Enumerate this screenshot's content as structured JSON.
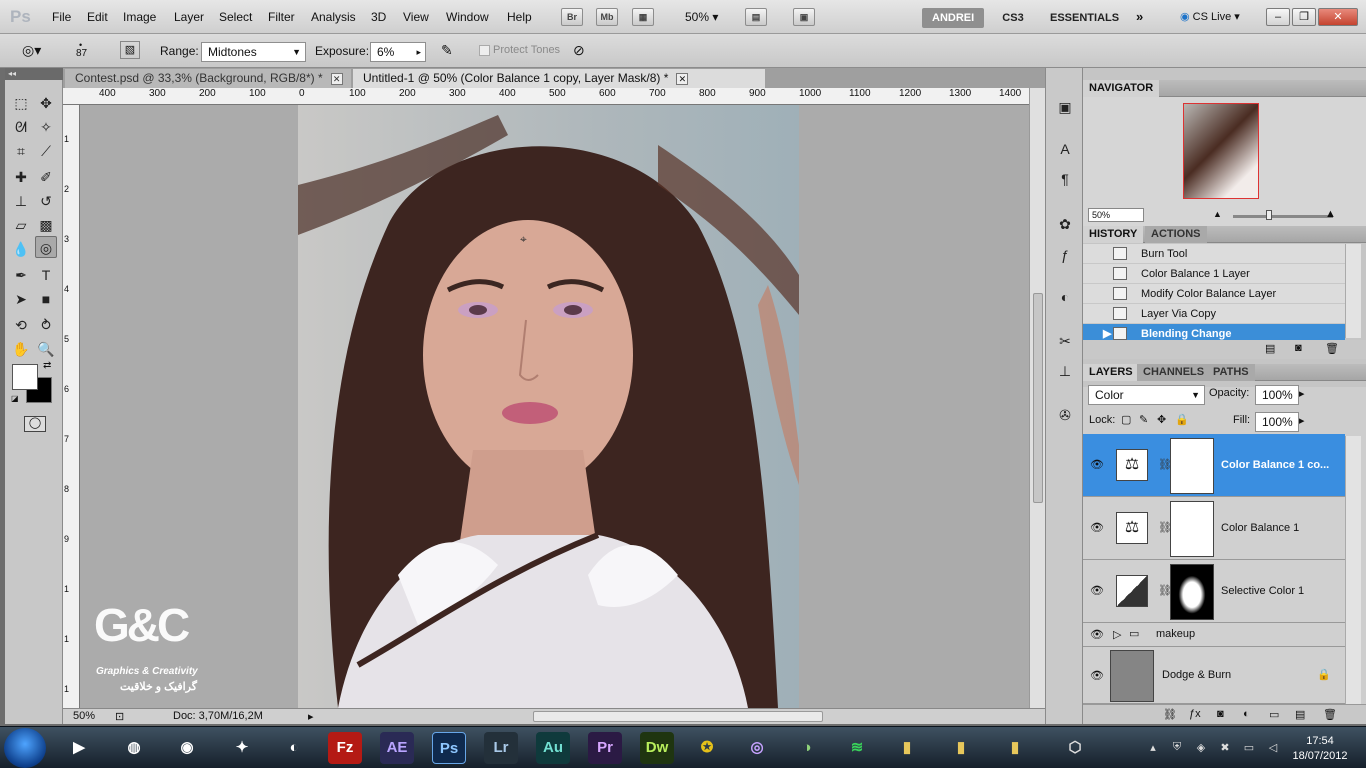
{
  "app": {
    "logo": "Ps"
  },
  "menu": [
    "File",
    "Edit",
    "Image",
    "Layer",
    "Select",
    "Filter",
    "Analysis",
    "3D",
    "View",
    "Window",
    "Help"
  ],
  "menubar_buttons": [
    "Br",
    "Mb"
  ],
  "zoom": "50%",
  "workspaces": {
    "active": "ANDREI",
    "cs3": "CS3",
    "essentials": "ESSENTIALS"
  },
  "cslive": "CS Live",
  "window_controls": {
    "min": "–",
    "restore": "❐",
    "close": "✕"
  },
  "options": {
    "brush_size": "87",
    "range_label": "Range:",
    "range_value": "Midtones",
    "exposure_label": "Exposure:",
    "exposure_value": "6%",
    "protect_tones": "Protect Tones"
  },
  "tabs": [
    {
      "label": "Contest.psd @ 33,3% (Background, RGB/8*) *"
    },
    {
      "label": "Untitled-1 @ 50% (Color Balance 1 copy, Layer Mask/8) *"
    }
  ],
  "ruler": [
    "400",
    "300",
    "200",
    "100",
    "0",
    "100",
    "200",
    "300",
    "400",
    "500",
    "600",
    "700",
    "800",
    "900",
    "1000",
    "1100",
    "1200",
    "1300",
    "1400"
  ],
  "ruler_v": [
    "1",
    "2",
    "3",
    "4",
    "5",
    "6",
    "7",
    "8",
    "9",
    "1",
    "1",
    "1"
  ],
  "status": {
    "zoom": "50%",
    "doc": "Doc: 3,70M/16,2M"
  },
  "watermark": {
    "logo": "G&C",
    "subtitle": "Graphics & Creativity",
    "arabic": "گرافیک و خلاقیت"
  },
  "navigator": {
    "title": "NAVIGATOR",
    "zoom": "50%"
  },
  "history": {
    "tabs": [
      "HISTORY",
      "ACTIONS"
    ],
    "items": [
      "Burn Tool",
      "Color Balance 1 Layer",
      "Modify Color Balance Layer",
      "Layer Via Copy",
      "Blending Change"
    ],
    "selected_index": 4
  },
  "layers": {
    "tabs": [
      "LAYERS",
      "CHANNELS",
      "PATHS"
    ],
    "blend_mode": "Color",
    "opacity_label": "Opacity:",
    "opacity": "100%",
    "lock_label": "Lock:",
    "fill_label": "Fill:",
    "fill": "100%",
    "items": [
      {
        "name": "Color Balance 1 co...",
        "selected": true
      },
      {
        "name": "Color Balance 1",
        "selected": false
      },
      {
        "name": "Selective Color 1",
        "selected": false
      },
      {
        "name": "makeup",
        "group": true
      },
      {
        "name": "Dodge & Burn",
        "locked": true
      }
    ]
  },
  "clock": {
    "time": "17:54",
    "date": "18/07/2012"
  },
  "taskbar": [
    "AE",
    "Ps",
    "Lr",
    "Au",
    "Pr",
    "Dw"
  ],
  "colors": {
    "selection": "#3a8ee0",
    "ps_blue": "#0f2a4e"
  }
}
